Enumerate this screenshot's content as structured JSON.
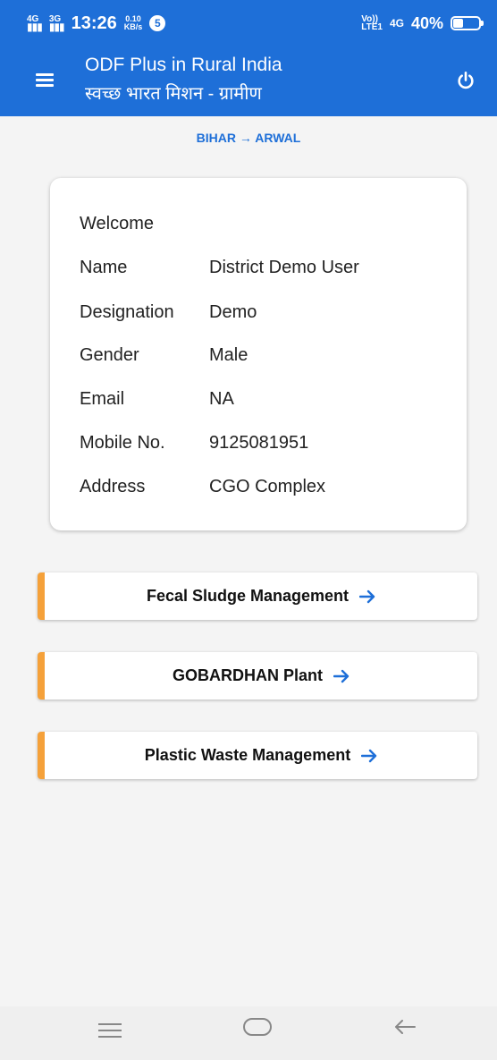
{
  "status_bar": {
    "sim1_network": "4G",
    "sim2_network": "3G",
    "time": "13:26",
    "speed_value": "0.10",
    "speed_unit": "KB/s",
    "notification_badge": "5",
    "volte_top": "Vo))",
    "volte_bottom": "LTE1",
    "network_right": "4G",
    "battery_text": "40%",
    "battery_level_percent": 40
  },
  "app_bar": {
    "title": "ODF Plus in Rural India",
    "subtitle": "स्वच्छ भारत मिशन - ग्रामीण",
    "menu_icon": "hamburger-menu-icon",
    "power_icon": "power-icon"
  },
  "breadcrumb": {
    "text": "BIHAR → ARWAL"
  },
  "profile_card": {
    "heading": "Welcome",
    "rows": [
      {
        "label": "Name",
        "value": "District Demo User"
      },
      {
        "label": "Designation",
        "value": "Demo"
      },
      {
        "label": "Gender",
        "value": "Male"
      },
      {
        "label": "Email",
        "value": "NA"
      },
      {
        "label": "Mobile No.",
        "value": "9125081951"
      },
      {
        "label": "Address",
        "value": "CGO Complex"
      }
    ]
  },
  "actions": [
    {
      "label": "Fecal Sludge Management",
      "icon": "arrow-right-icon"
    },
    {
      "label": "GOBARDHAN Plant",
      "icon": "arrow-right-icon"
    },
    {
      "label": "Plastic Waste Management",
      "icon": "arrow-right-icon"
    }
  ],
  "nav_bar": {
    "icons": [
      "recent-apps-icon",
      "home-icon",
      "back-icon"
    ]
  },
  "colors": {
    "primary_blue": "#1e6fd8",
    "accent_orange": "#f5a13a",
    "background": "#f4f4f4",
    "card_background": "#ffffff"
  }
}
